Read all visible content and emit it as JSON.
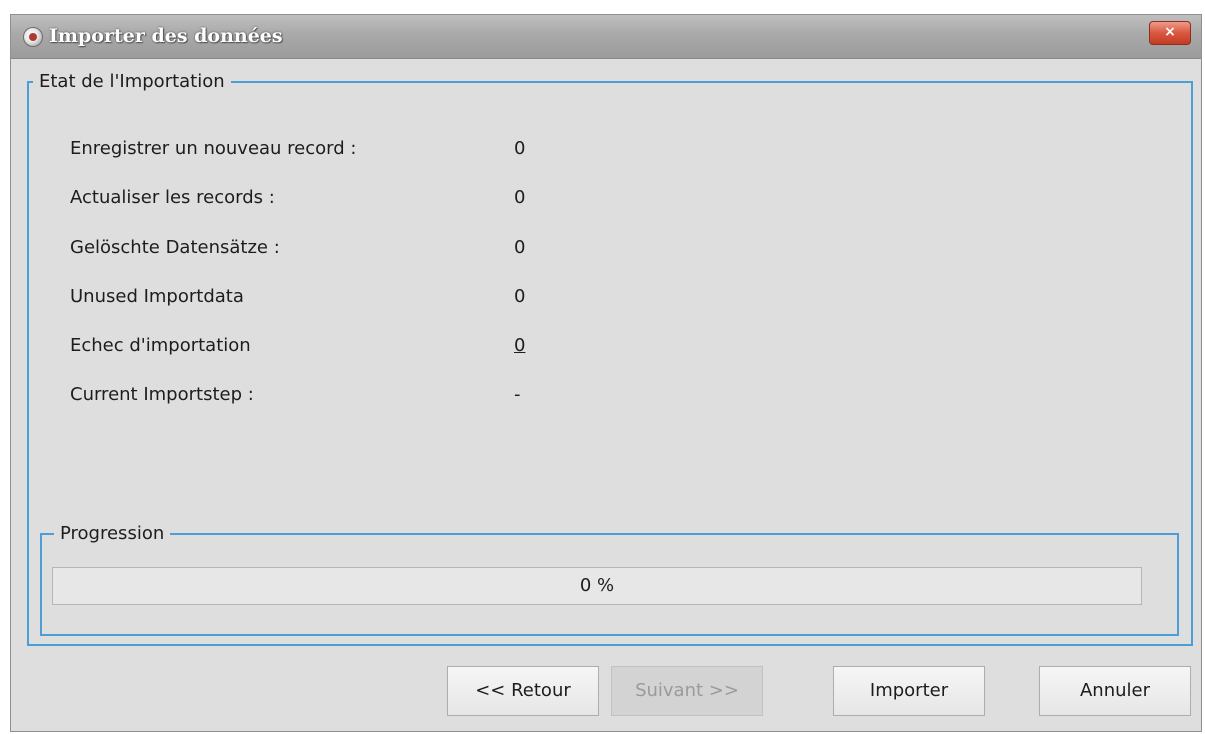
{
  "window": {
    "title": "Importer des données",
    "close_label": "×"
  },
  "import_status": {
    "legend": "Etat de l'Importation",
    "rows": [
      {
        "label": "Enregistrer un nouveau record :",
        "value": "0"
      },
      {
        "label": "Actualiser les records :",
        "value": "0"
      },
      {
        "label": "Gelöschte Datensätze :",
        "value": "0"
      },
      {
        "label": "Unused Importdata",
        "value": "0"
      },
      {
        "label": "Echec d'importation",
        "value": "0"
      },
      {
        "label": "Current Importstep :",
        "value": "-"
      }
    ]
  },
  "progress": {
    "legend": "Progression",
    "percent": 0,
    "text": "0 %"
  },
  "buttons": {
    "back": "<< Retour",
    "next": "Suivant >>",
    "import": "Importer",
    "cancel": "Annuler"
  }
}
